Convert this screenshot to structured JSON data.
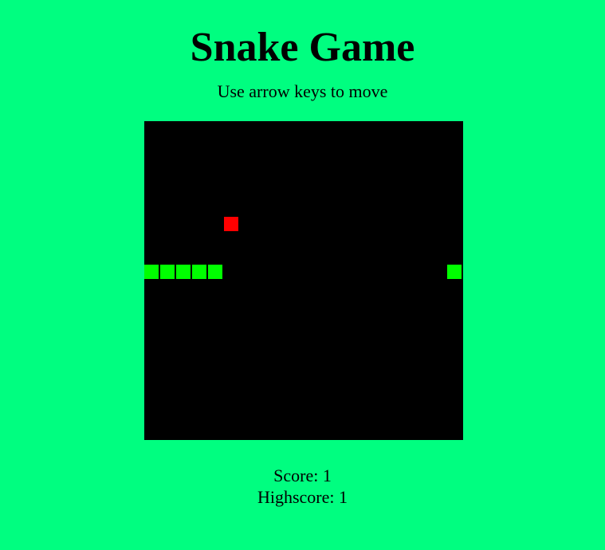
{
  "header": {
    "title": "Snake Game",
    "subtitle": "Use arrow keys to move"
  },
  "board": {
    "grid_cols": 20,
    "grid_rows": 20,
    "background_color": "#000000",
    "snake_color": "#00ff00",
    "food_color": "#ff0000",
    "snake": [
      {
        "col": 0,
        "row": 9
      },
      {
        "col": 1,
        "row": 9
      },
      {
        "col": 2,
        "row": 9
      },
      {
        "col": 3,
        "row": 9
      },
      {
        "col": 4,
        "row": 9
      },
      {
        "col": 19,
        "row": 9
      }
    ],
    "food": {
      "col": 5,
      "row": 6
    }
  },
  "stats": {
    "score_label": "Score:",
    "score": "1",
    "highscore_label": "Highscore:",
    "highscore": "1"
  },
  "page": {
    "background_color": "#00fe80"
  }
}
